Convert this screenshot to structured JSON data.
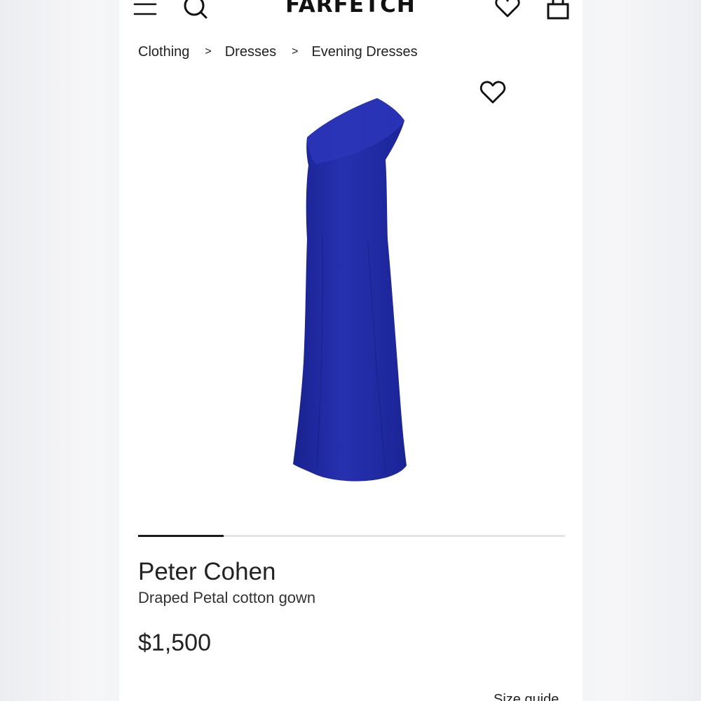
{
  "header": {
    "brand": "FARFETCH",
    "icons": [
      "menu-icon",
      "search-icon",
      "heart-icon",
      "shopping-bag-icon"
    ]
  },
  "breadcrumb": {
    "items": [
      "Clothing",
      "Dresses",
      "Evening Dresses"
    ],
    "separator": ">"
  },
  "gallery": {
    "progress": 0.2,
    "dress_color": "#1f2aa3"
  },
  "product": {
    "brand": "Peter Cohen",
    "name": "Draped Petal cotton gown",
    "price": "$1,500",
    "size_guide_label": "Size guide"
  }
}
